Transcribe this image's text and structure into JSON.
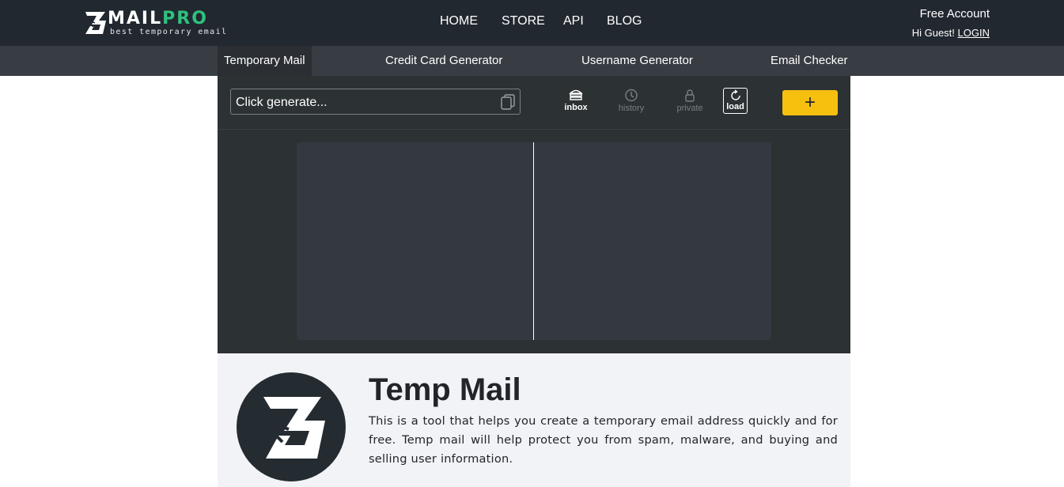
{
  "header": {
    "logo_word_a": "MAIL",
    "logo_word_b": "PRO",
    "logo_tagline": "best temporary email",
    "nav": [
      "HOME",
      "STORE",
      "API",
      "BLOG"
    ],
    "account_label": "Free Account",
    "greeting": "Hi Guest!",
    "login_label": "LOGIN"
  },
  "subnav": {
    "tabs": [
      "Temporary Mail",
      "Credit Card Generator",
      "Username Generator",
      "Email Checker"
    ],
    "active_tab": "Temporary Mail"
  },
  "tool": {
    "email_placeholder": "Click generate...",
    "buttons": {
      "inbox": "inbox",
      "history": "history",
      "private": "private",
      "load": "load"
    },
    "add_label": "+"
  },
  "info": {
    "title": "Temp Mail",
    "description": "This is a tool that helps you create a temporary email address quickly and for free. Temp mail will help protect you from spam, malware, and buying and selling user information."
  },
  "colors": {
    "header_bg": "#222830",
    "subnav_bg": "#383c43",
    "panel_bg": "#2c3133",
    "accent_green": "#2ec27e",
    "accent_yellow": "#f7c00f",
    "info_bg": "#f2f3f7"
  },
  "icons": [
    "logo-mark-icon",
    "copy-icon",
    "inbox-icon",
    "history-icon",
    "lock-icon",
    "refresh-icon",
    "plus-icon",
    "envelope-logo-icon"
  ]
}
